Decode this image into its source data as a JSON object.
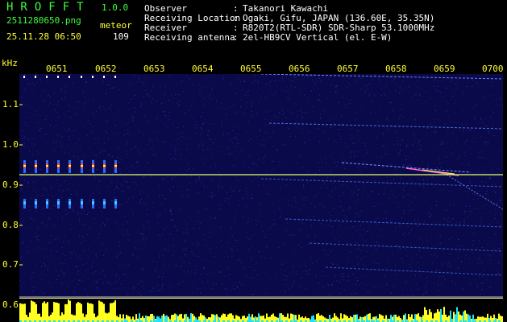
{
  "header": {
    "app_title": "HROFFT",
    "app_version": "1.0.0",
    "filename": "2511280650.png",
    "mode_label": "meteor",
    "datetime": "25.11.28 06:50",
    "count": "109"
  },
  "info": [
    {
      "key": "Observer",
      "value": "Takanori Kawachi"
    },
    {
      "key": "Receiving Location",
      "value": "Ogaki, Gifu, JAPAN (136.60E, 35.35N)"
    },
    {
      "key": "Receiver",
      "value": "R820T2(RTL-SDR) SDR-Sharp 53.1000MHz"
    },
    {
      "key": "Receiving antenna",
      "value": "2el-HB9CV Vertical (el. E-W)"
    }
  ],
  "info_separator": ":",
  "axes": {
    "unit_label": "kHz",
    "time_ticks": [
      "0651",
      "0652",
      "0653",
      "0654",
      "0655",
      "0656",
      "0657",
      "0658",
      "0659",
      "0700"
    ],
    "freq_ticks": [
      "1.1",
      "1.0",
      "0.9",
      "0.8",
      "0.7",
      "0.6"
    ]
  },
  "colors": {
    "background": "#0a0a4a",
    "title_green": "#3cff3c",
    "axis_yellow": "#ffff33",
    "reference_line": "#e8ff6a"
  }
}
